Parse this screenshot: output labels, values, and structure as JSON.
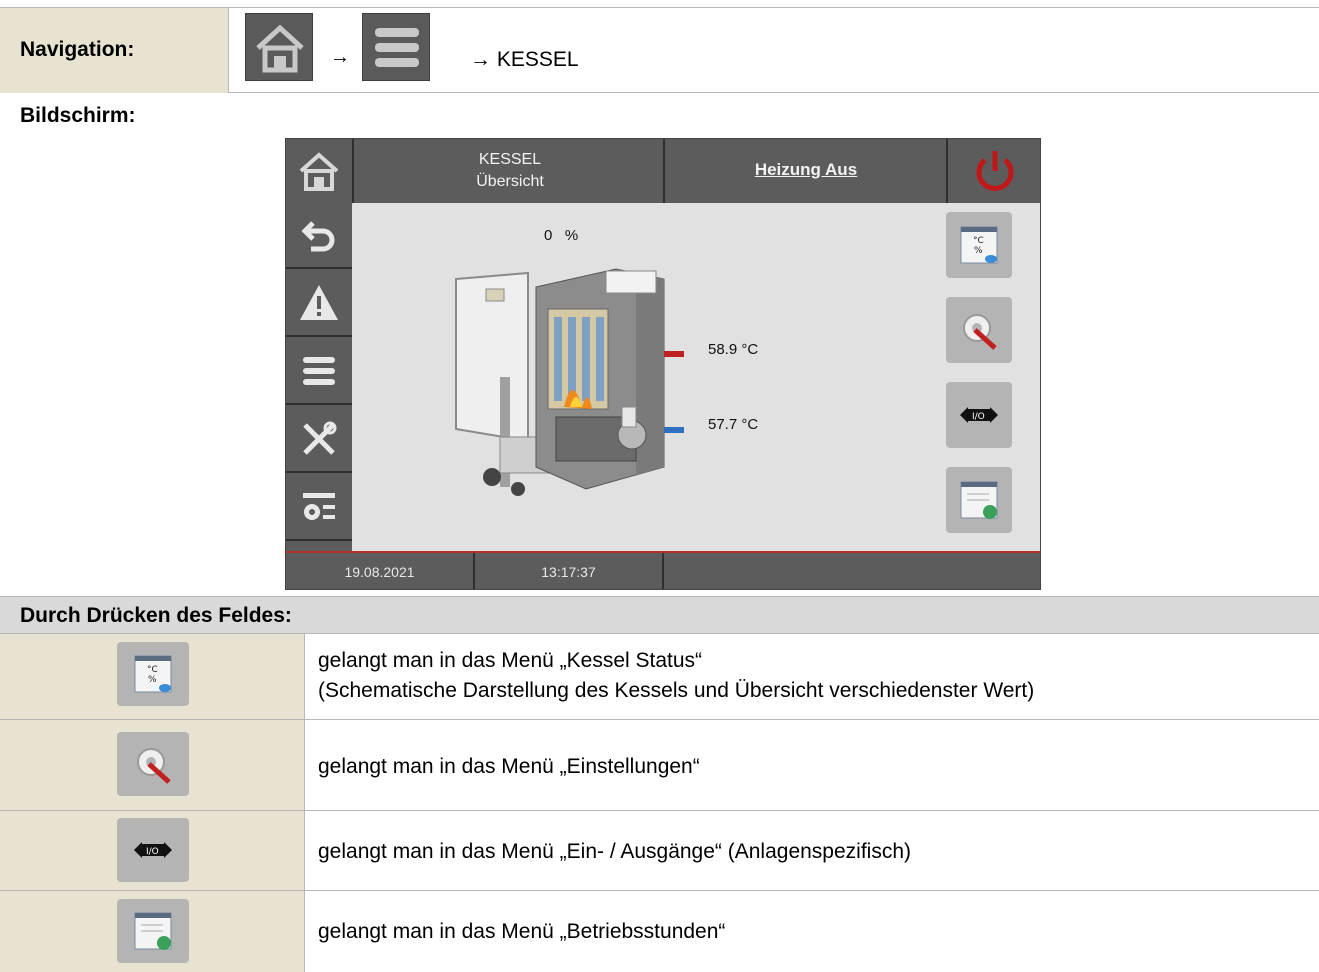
{
  "navigation": {
    "label": "Navigation:",
    "arrow": "→",
    "target": "→ KESSEL",
    "icons": [
      "home-icon",
      "menu-icon"
    ]
  },
  "screen": {
    "label": "Bildschirm:",
    "header": {
      "title_line1": "KESSEL",
      "title_line2": "Übersicht",
      "status": "Heizung Aus"
    },
    "sidebar_icons": [
      "home-icon",
      "back-icon",
      "warning-icon",
      "menu-icon",
      "tools-icon",
      "settings-list-icon"
    ],
    "percent_value": "0",
    "percent_unit": "%",
    "temp_flow": "58.9 °C",
    "temp_return": "57.7 °C",
    "footer": {
      "date": "19.08.2021",
      "time": "13:17:37"
    }
  },
  "press": {
    "label": "Durch Drücken des Feldes:",
    "rows": [
      {
        "icon": "status-view-icon",
        "line1": "gelangt man in das Menü „Kessel Status“",
        "line2": "(Schematische Darstellung des Kessels und Übersicht verschiedenster Wert)"
      },
      {
        "icon": "settings-icon",
        "line1": "gelangt man in das Menü „Einstellungen“",
        "line2": ""
      },
      {
        "icon": "io-icon",
        "line1": "gelangt man in das Menü „Ein- / Ausgänge“ (Anlagenspezifisch)",
        "line2": ""
      },
      {
        "icon": "operating-hours-icon",
        "line1": "gelangt man in das Menü „Betriebsstunden“",
        "line2": ""
      }
    ]
  },
  "colors": {
    "panel_dark": "#5c5c5c",
    "screen_bg": "#e1e1e1",
    "label_cell": "#e8e3d0",
    "power_red": "#c01818"
  }
}
